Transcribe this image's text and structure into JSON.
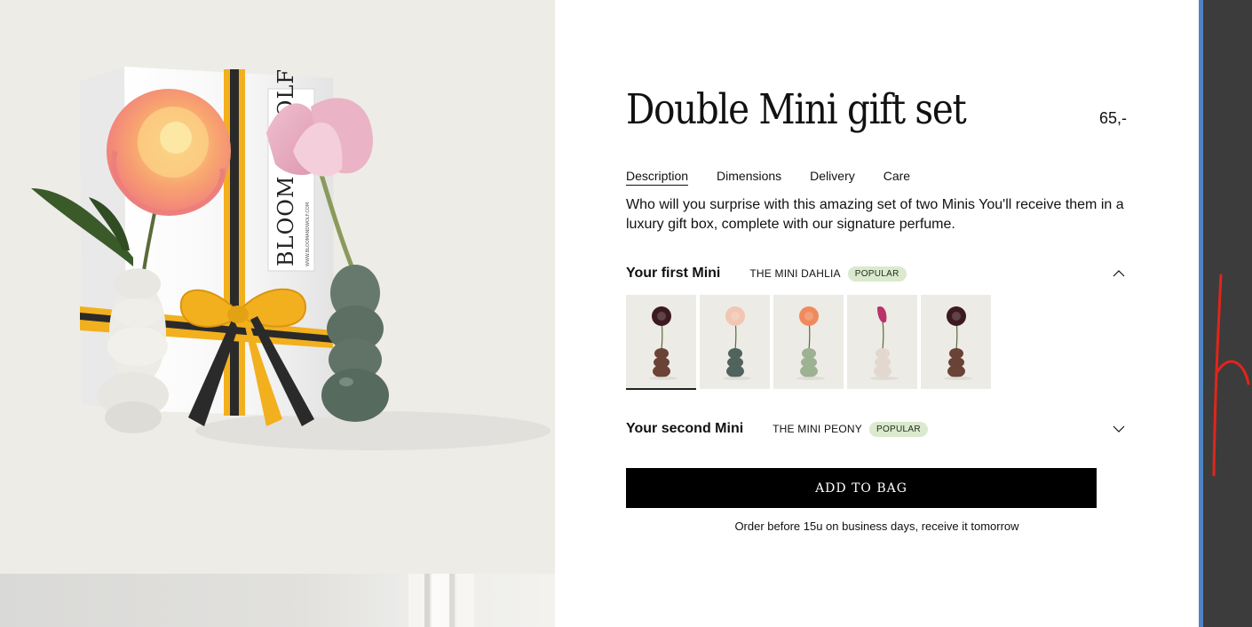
{
  "product": {
    "title": "Double Mini gift set",
    "price": "65,-",
    "description": "Who will you surprise with this amazing set of two Minis You'll receive them in a luxury gift box, complete with our signature perfume."
  },
  "tabs": [
    {
      "label": "Description",
      "active": true
    },
    {
      "label": "Dimensions",
      "active": false
    },
    {
      "label": "Delivery",
      "active": false
    },
    {
      "label": "Care",
      "active": false
    }
  ],
  "gift_box": {
    "brand_lettering": "BLOOM & WOLF",
    "url_lettering": "WWW.BLOOMANDWOLF.COM"
  },
  "first_mini": {
    "label": "Your first Mini",
    "name": "THE MINI DAHLIA",
    "badge": "POPULAR",
    "expanded": true,
    "chevron_icon": "chevron-up-icon",
    "options": [
      {
        "flower": "dahlia",
        "flower_color": "#3d1a22",
        "vase_color": "#6a4236",
        "selected": true
      },
      {
        "flower": "peony",
        "flower_color": "#f1c6b3",
        "vase_color": "#50635d",
        "selected": false
      },
      {
        "flower": "rose",
        "flower_color": "#f08a5d",
        "vase_color": "#9db193",
        "selected": false
      },
      {
        "flower": "calla",
        "flower_color": "#b9336b",
        "vase_color": "#e2d8d0",
        "selected": false
      },
      {
        "flower": "dahlia",
        "flower_color": "#3d1a22",
        "vase_color": "#6a4236",
        "selected": false
      }
    ]
  },
  "second_mini": {
    "label": "Your second Mini",
    "name": "THE MINI PEONY",
    "badge": "POPULAR",
    "expanded": false,
    "chevron_icon": "chevron-down-icon"
  },
  "cart": {
    "button_label": "ADD TO BAG",
    "order_note": "Order before 15u on business days, receive it tomorrow"
  },
  "colors": {
    "badge_bg": "#dbe9cf",
    "button_bg": "#000000",
    "ribbon": "#f2b01e",
    "side_bar_dark": "#3c3c3c",
    "side_bar_blue": "#4f84c4",
    "scribble_red": "#e1251b"
  }
}
